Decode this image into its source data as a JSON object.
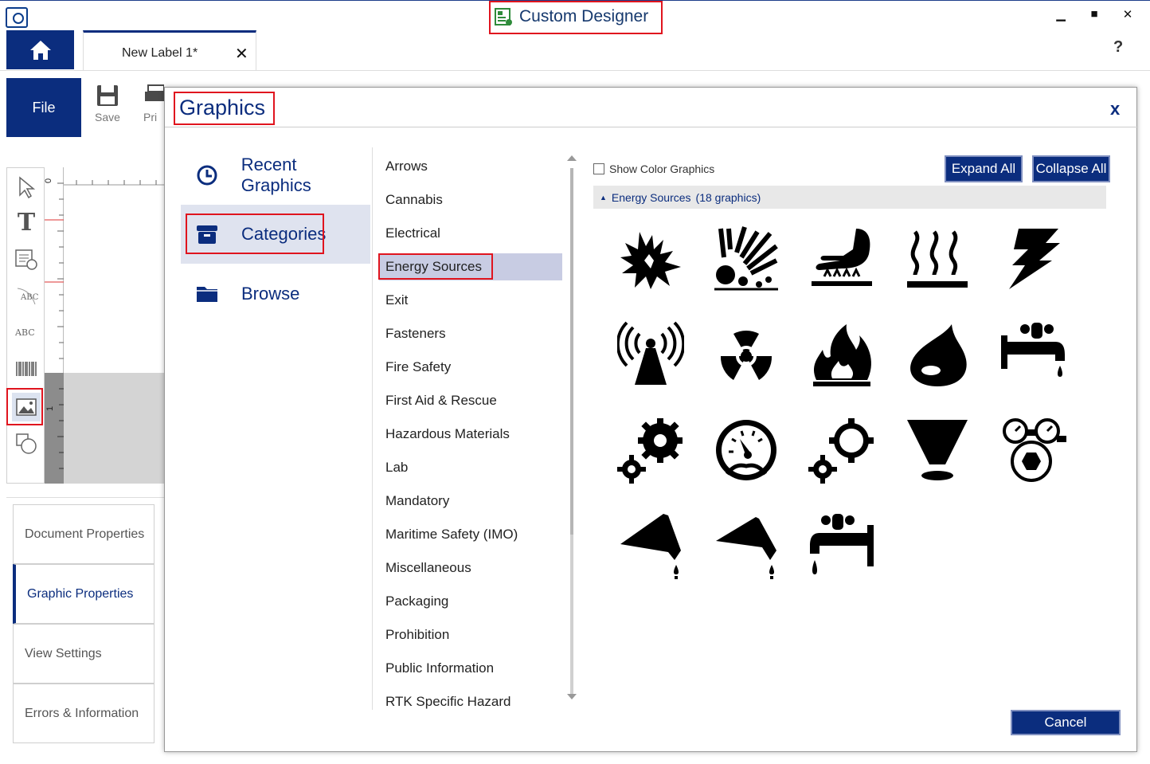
{
  "window": {
    "title": "Custom Designer",
    "minimize": "▁",
    "maximize": "■",
    "close": "✕"
  },
  "tabs": {
    "document_tab": "New Label 1*",
    "close": "✕",
    "help": "?"
  },
  "ribbon": {
    "file_label": "File",
    "save_label": "Save",
    "print_label": "Pri"
  },
  "properties_panel": {
    "tabs": [
      {
        "label": "Document Properties",
        "active": false
      },
      {
        "label": "Graphic Properties",
        "active": true
      },
      {
        "label": "View Settings",
        "active": false
      },
      {
        "label": "Errors & Information",
        "active": false
      }
    ]
  },
  "dialog": {
    "title": "Graphics",
    "close": "x",
    "nav": [
      {
        "label": "Recent Graphics",
        "icon": "clock-icon",
        "active": false
      },
      {
        "label": "Categories",
        "icon": "archive-box-icon",
        "active": true
      },
      {
        "label": "Browse",
        "icon": "folder-icon",
        "active": false
      }
    ],
    "categories": [
      "Arrows",
      "Cannabis",
      "Electrical",
      "Energy Sources",
      "Exit",
      "Fasteners",
      "Fire Safety",
      "First Aid & Rescue",
      "Hazardous Materials",
      "Lab",
      "Mandatory",
      "Maritime Safety (IMO)",
      "Miscellaneous",
      "Packaging",
      "Prohibition",
      "Public Information",
      "RTK Specific Hazard"
    ],
    "selected_category": "Energy Sources",
    "show_color_label": "Show Color Graphics",
    "show_color_checked": false,
    "expand_all": "Expand All",
    "collapse_all": "Collapse All",
    "group": {
      "name": "Energy Sources",
      "count_label": "(18 graphics)"
    },
    "graphics": [
      "explosion-icon",
      "exploding-debris-icon",
      "hot-surface-hand-icon",
      "heat-waves-icon",
      "lightning-bolt-icon",
      "radio-tower-icon",
      "radiation-icon",
      "flame-icon",
      "liquid-drop-icon",
      "faucet-drip-icon",
      "gears-icon",
      "pressure-gauge-icon",
      "gears-outline-icon",
      "funnel-icon",
      "gas-regulator-icon",
      "funnel-drip-icon",
      "funnel-drip-alt-icon",
      "valve-drip-icon"
    ],
    "cancel": "Cancel"
  },
  "colors": {
    "brand_navy": "#0b2d7e",
    "highlight_red": "#e0141e",
    "selection": "#c8cce3"
  }
}
